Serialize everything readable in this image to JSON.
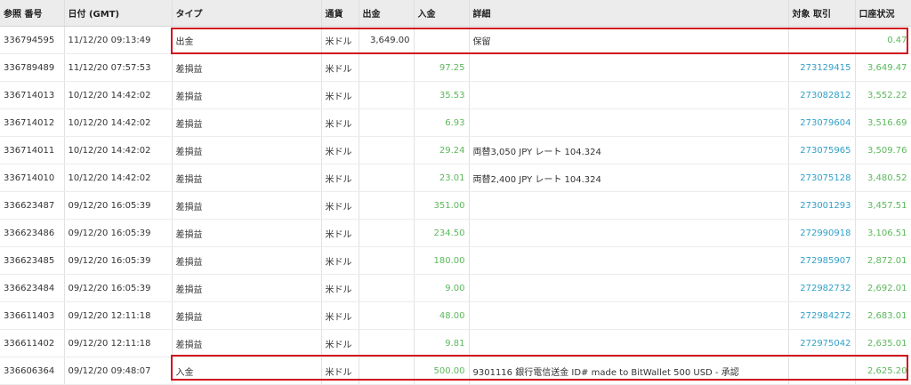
{
  "columns": {
    "ref": "参照 番号",
    "date": "日付 (GMT)",
    "type": "タイプ",
    "currency": "通貨",
    "out": "出金",
    "in": "入金",
    "detail": "詳細",
    "target": "対象 取引",
    "balance": "口座状況"
  },
  "rows": [
    {
      "ref": "336794595",
      "date": "11/12/20 09:13:49",
      "type": "出金",
      "currency": "米ドル",
      "out": "3,649.00",
      "in": "",
      "detail": "保留",
      "target": "",
      "balance": "0.47"
    },
    {
      "ref": "336789489",
      "date": "11/12/20 07:57:53",
      "type": "差損益",
      "currency": "米ドル",
      "out": "",
      "in": "97.25",
      "detail": "",
      "target": "273129415",
      "balance": "3,649.47"
    },
    {
      "ref": "336714013",
      "date": "10/12/20 14:42:02",
      "type": "差損益",
      "currency": "米ドル",
      "out": "",
      "in": "35.53",
      "detail": "",
      "target": "273082812",
      "balance": "3,552.22"
    },
    {
      "ref": "336714012",
      "date": "10/12/20 14:42:02",
      "type": "差損益",
      "currency": "米ドル",
      "out": "",
      "in": "6.93",
      "detail": "",
      "target": "273079604",
      "balance": "3,516.69"
    },
    {
      "ref": "336714011",
      "date": "10/12/20 14:42:02",
      "type": "差損益",
      "currency": "米ドル",
      "out": "",
      "in": "29.24",
      "detail": "両替3,050 JPY レート 104.324",
      "target": "273075965",
      "balance": "3,509.76"
    },
    {
      "ref": "336714010",
      "date": "10/12/20 14:42:02",
      "type": "差損益",
      "currency": "米ドル",
      "out": "",
      "in": "23.01",
      "detail": "両替2,400 JPY レート 104.324",
      "target": "273075128",
      "balance": "3,480.52"
    },
    {
      "ref": "336623487",
      "date": "09/12/20 16:05:39",
      "type": "差損益",
      "currency": "米ドル",
      "out": "",
      "in": "351.00",
      "detail": "",
      "target": "273001293",
      "balance": "3,457.51"
    },
    {
      "ref": "336623486",
      "date": "09/12/20 16:05:39",
      "type": "差損益",
      "currency": "米ドル",
      "out": "",
      "in": "234.50",
      "detail": "",
      "target": "272990918",
      "balance": "3,106.51"
    },
    {
      "ref": "336623485",
      "date": "09/12/20 16:05:39",
      "type": "差損益",
      "currency": "米ドル",
      "out": "",
      "in": "180.00",
      "detail": "",
      "target": "272985907",
      "balance": "2,872.01"
    },
    {
      "ref": "336623484",
      "date": "09/12/20 16:05:39",
      "type": "差損益",
      "currency": "米ドル",
      "out": "",
      "in": "9.00",
      "detail": "",
      "target": "272982732",
      "balance": "2,692.01"
    },
    {
      "ref": "336611403",
      "date": "09/12/20 12:11:18",
      "type": "差損益",
      "currency": "米ドル",
      "out": "",
      "in": "48.00",
      "detail": "",
      "target": "272984272",
      "balance": "2,683.01"
    },
    {
      "ref": "336611402",
      "date": "09/12/20 12:11:18",
      "type": "差損益",
      "currency": "米ドル",
      "out": "",
      "in": "9.81",
      "detail": "",
      "target": "272975042",
      "balance": "2,635.01"
    },
    {
      "ref": "336606364",
      "date": "09/12/20 09:48:07",
      "type": "入金",
      "currency": "米ドル",
      "out": "",
      "in": "500.00",
      "detail": "9301116 銀行電信送金 ID# made to BitWallet 500 USD - 承認",
      "target": "",
      "balance": "2,625.20"
    }
  ],
  "colors": {
    "amount_green": "#5cb85c",
    "link_blue": "#31a0c7",
    "highlight_red": "#d0141e",
    "header_bg": "#ececec"
  }
}
